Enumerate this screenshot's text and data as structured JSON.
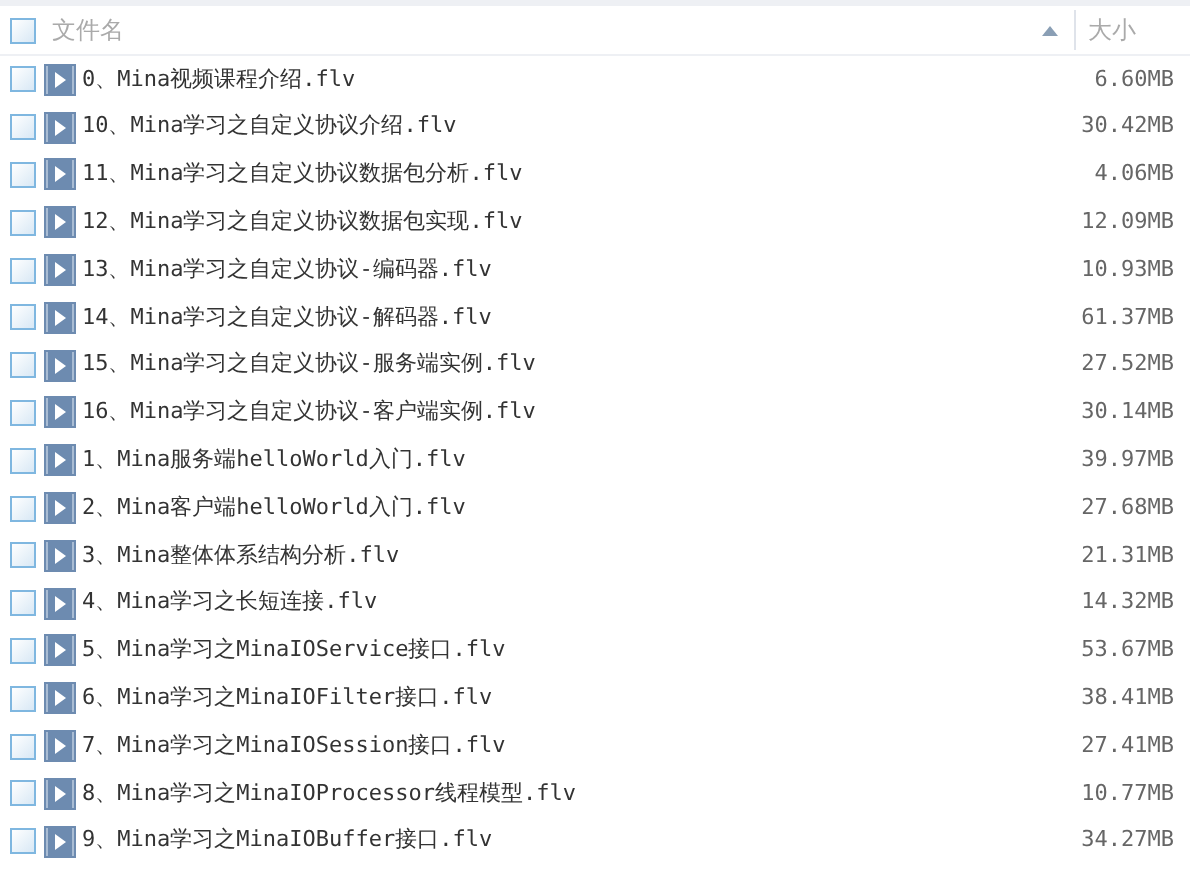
{
  "header": {
    "name_column": "文件名",
    "size_column": "大小",
    "select_all_checked": false,
    "sorted_ascending": true
  },
  "files": [
    {
      "name": "0、Mina视频课程介绍.flv",
      "size": "6.60MB",
      "checked": false
    },
    {
      "name": "10、Mina学习之自定义协议介绍.flv",
      "size": "30.42MB",
      "checked": false
    },
    {
      "name": "11、Mina学习之自定义协议数据包分析.flv",
      "size": "4.06MB",
      "checked": false
    },
    {
      "name": "12、Mina学习之自定义协议数据包实现.flv",
      "size": "12.09MB",
      "checked": false
    },
    {
      "name": "13、Mina学习之自定义协议-编码器.flv",
      "size": "10.93MB",
      "checked": false
    },
    {
      "name": "14、Mina学习之自定义协议-解码器.flv",
      "size": "61.37MB",
      "checked": false
    },
    {
      "name": "15、Mina学习之自定义协议-服务端实例.flv",
      "size": "27.52MB",
      "checked": false
    },
    {
      "name": "16、Mina学习之自定义协议-客户端实例.flv",
      "size": "30.14MB",
      "checked": false
    },
    {
      "name": "1、Mina服务端helloWorld入门.flv",
      "size": "39.97MB",
      "checked": false
    },
    {
      "name": "2、Mina客户端helloWorld入门.flv",
      "size": "27.68MB",
      "checked": false
    },
    {
      "name": "3、Mina整体体系结构分析.flv",
      "size": "21.31MB",
      "checked": false
    },
    {
      "name": "4、Mina学习之长短连接.flv",
      "size": "14.32MB",
      "checked": false
    },
    {
      "name": "5、Mina学习之MinaIOService接口.flv",
      "size": "53.67MB",
      "checked": false
    },
    {
      "name": "6、Mina学习之MinaIOFilter接口.flv",
      "size": "38.41MB",
      "checked": false
    },
    {
      "name": "7、Mina学习之MinaIOSession接口.flv",
      "size": "27.41MB",
      "checked": false
    },
    {
      "name": "8、Mina学习之MinaIOProcessor线程模型.flv",
      "size": "10.77MB",
      "checked": false
    },
    {
      "name": "9、Mina学习之MinaIOBuffer接口.flv",
      "size": "34.27MB",
      "checked": false
    }
  ]
}
